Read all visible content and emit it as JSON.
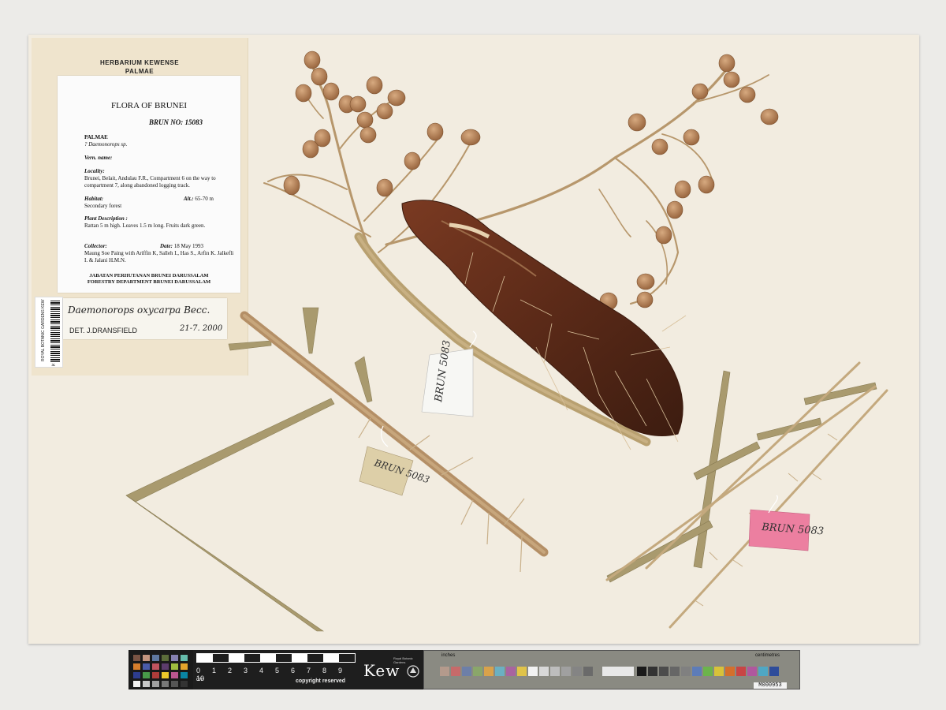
{
  "herbarium_header": {
    "line1": "HERBARIUM KEWENSE",
    "line2": "PALMAE"
  },
  "main_label": {
    "title": "FLORA OF BRUNEI",
    "brun_no": "BRUN NO: 15083",
    "family": "PALMAE",
    "genus": "? Daemonorops sp.",
    "vern_heading": "Vern. name:",
    "locality_heading": "Locality:",
    "locality_text": "Brunei, Belait, Andulau F.R., Compartment 6 on the way to compartment 7, along abandoned logging track.",
    "habitat_heading": "Habitat:",
    "habitat_text": "Secondary forest",
    "alt_label": "Alt.:",
    "alt_value": "65-70 m",
    "plant_desc_heading": "Plant Description :",
    "plant_desc_text": "Rattan 5 m high. Leaves 1.5 m long. Fruits dark green.",
    "collector_heading": "Collector:",
    "date_label": "Date:",
    "date_value": "18 May 1993",
    "collector_text": "Maung Soe Paing with Ariffin K, Salleh I., Has S., Arfin K. Jalkefli I. & Jalani H.M.N.",
    "footer_line1": "JABATAN PERHUTANAN BRUNEI DARUSSALAM",
    "footer_line2": "FORESTRY DEPARTMENT BRUNEI DARUSSALAM"
  },
  "barcode": {
    "institution": "ROYAL BOTANIC GARDENS KEW",
    "id": "K000113134"
  },
  "determination": {
    "name": "Daemonorops oxycarpa Becc.",
    "det_by": "DET. J.DRANSFIELD",
    "date": "21-7. 2000"
  },
  "specimen_tags": {
    "tag1": "BRUN 5083",
    "tag2": "BRUN 5083",
    "tag3": "BRUN 5083"
  },
  "ruler": {
    "numbers": [
      "0",
      "1",
      "2",
      "3",
      "4",
      "5",
      "6",
      "7",
      "8",
      "9",
      "10"
    ],
    "unit": "cm",
    "copyright": "copyright reserved"
  },
  "kew_logo": {
    "word": "Kew",
    "sub": "Royal Botanic Gardens"
  },
  "grey_card": {
    "inches": "inches",
    "centimetres": "centimetres",
    "id": "M000953"
  },
  "colors": {
    "sheet": "#f2ece0",
    "stem": "#b48f66",
    "fruit": "#b98256",
    "pink_tag": "#ec7fa0",
    "leaf": "#a99a6e"
  }
}
